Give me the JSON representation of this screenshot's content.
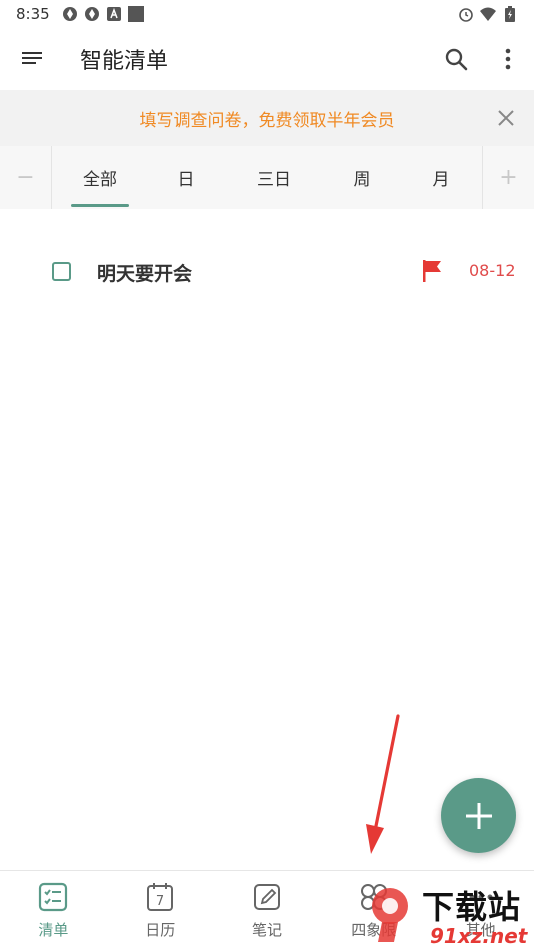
{
  "status_bar": {
    "time": "8:35"
  },
  "app_bar": {
    "title": "智能清单"
  },
  "banner": {
    "text": "填写调查问卷，免费领取半年会员"
  },
  "tabs": {
    "minus": "−",
    "plus": "+",
    "items": [
      {
        "label": "全部",
        "active": true
      },
      {
        "label": "日"
      },
      {
        "label": "三日"
      },
      {
        "label": "周"
      },
      {
        "label": "月"
      }
    ]
  },
  "tasks": [
    {
      "title": "明天要开会",
      "due": "08-12",
      "flag_color": "#e53935",
      "checked": false
    }
  ],
  "bottom_nav": {
    "items": [
      {
        "label": "清单",
        "icon": "checklist-icon",
        "active": true
      },
      {
        "label": "日历",
        "icon": "calendar-icon",
        "badge": "7"
      },
      {
        "label": "笔记",
        "icon": "note-icon"
      },
      {
        "label": "四象限",
        "icon": "quadrant-icon"
      },
      {
        "label": "其他",
        "icon": "more-icon"
      }
    ]
  },
  "watermark": {
    "title": "下载站",
    "domain": "91xz.net"
  },
  "colors": {
    "accent": "#5a9a88",
    "banner_text": "#f08a24",
    "due": "#e04b4b",
    "annotation": "#e53935"
  }
}
